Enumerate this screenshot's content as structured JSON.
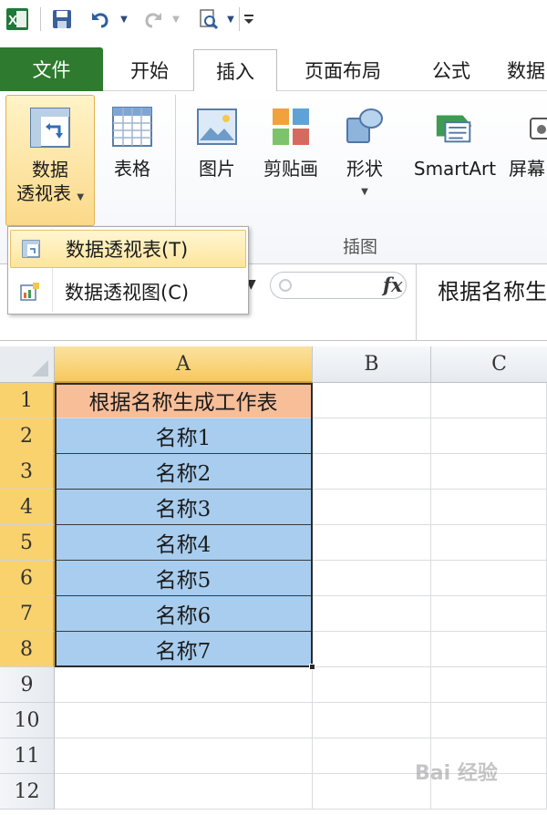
{
  "qat": {
    "app_icon": "excel-icon",
    "items": [
      "save-icon",
      "undo-icon",
      "redo-icon",
      "print-preview-icon",
      "customize-qat-icon"
    ]
  },
  "tabs": {
    "file": "文件",
    "home": "开始",
    "insert": "插入",
    "page_layout": "页面布局",
    "formulas": "公式",
    "data": "数据"
  },
  "ribbon": {
    "pivot_table_line1": "数据",
    "pivot_table_line2": "透视表",
    "table": "表格",
    "picture": "图片",
    "clip_art": "剪贴画",
    "shapes": "形状",
    "smartart": "SmartArt",
    "screenshot": "屏幕",
    "group_illustrations": "插图"
  },
  "menu": {
    "items": [
      {
        "label": "数据透视表(T)",
        "icon": "pivot-table-icon"
      },
      {
        "label": "数据透视图(C)",
        "icon": "pivot-chart-icon"
      }
    ]
  },
  "formula_bar": {
    "fx": "fx",
    "content": "根据名称生"
  },
  "sheet": {
    "columns": [
      "A",
      "B",
      "C"
    ],
    "rows": [
      "1",
      "2",
      "3",
      "4",
      "5",
      "6",
      "7",
      "8",
      "9",
      "10",
      "11",
      "12"
    ],
    "cells_a": [
      "根据名称生成工作表",
      "名称1",
      "名称2",
      "名称3",
      "名称4",
      "名称5",
      "名称6",
      "名称7"
    ]
  },
  "colors": {
    "file_tab": "#2e7a2e",
    "header_cell": "#f8be98",
    "value_cell": "#a8cdee",
    "selection_header": "#f9d26d"
  },
  "watermark": "Bai 经验"
}
